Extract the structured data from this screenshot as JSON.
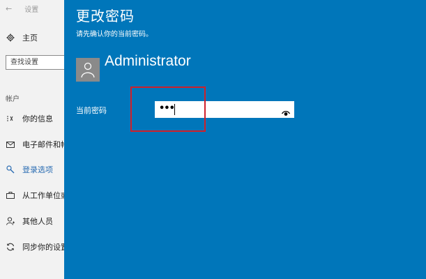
{
  "window": {
    "title": "设置"
  },
  "sidebar": {
    "home_label": "主页",
    "search_placeholder": "查找设置",
    "section_label": "帐户",
    "items": [
      {
        "icon": "contact-card-icon",
        "label": "你的信息"
      },
      {
        "icon": "mail-icon",
        "label": "电子邮件和帐户"
      },
      {
        "icon": "key-icon",
        "label": "登录选项",
        "active": true
      },
      {
        "icon": "briefcase-icon",
        "label": "从工作单位或学校访问"
      },
      {
        "icon": "add-person-icon",
        "label": "其他人员"
      },
      {
        "icon": "sync-icon",
        "label": "同步你的设置"
      }
    ]
  },
  "dialog": {
    "title": "更改密码",
    "subtitle": "请先确认你的当前密码。",
    "user_name": "Administrator",
    "password_label": "当前密码",
    "password_value": "•••",
    "background_color": "#0076ba"
  },
  "annotation": {
    "highlight_color": "#d0202a"
  }
}
